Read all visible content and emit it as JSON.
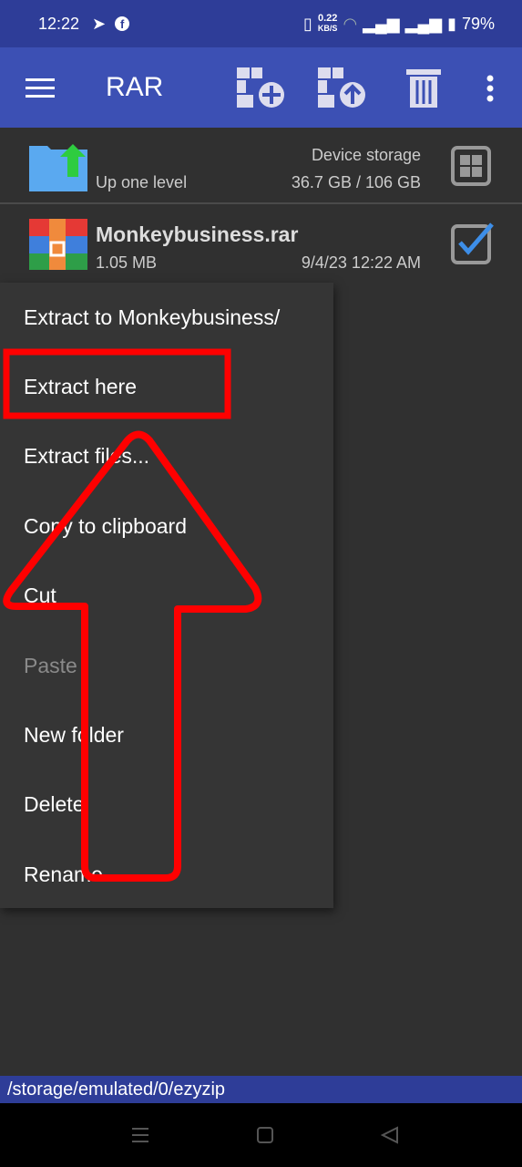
{
  "status": {
    "time": "12:22",
    "net_speed": "0.22",
    "net_unit": "KB/S",
    "battery": "79%"
  },
  "toolbar": {
    "title": "RAR"
  },
  "up_row": {
    "label": "Up one level",
    "storage_name": "Device storage",
    "storage_usage": "36.7 GB / 106 GB"
  },
  "file_row": {
    "name": "Monkeybusiness.rar",
    "size": "1.05 MB",
    "date": "9/4/23 12:22 AM",
    "checked": true
  },
  "menu": {
    "items": [
      {
        "label": "Extract to Monkeybusiness/"
      },
      {
        "label": "Extract here"
      },
      {
        "label": "Extract files..."
      },
      {
        "label": "Copy to clipboard"
      },
      {
        "label": "Cut"
      },
      {
        "label": "Paste",
        "disabled": true
      },
      {
        "label": "New folder"
      },
      {
        "label": "Delete"
      },
      {
        "label": "Rename"
      }
    ]
  },
  "path": "/storage/emulated/0/ezyzip",
  "annotation": {
    "color": "#ff0000",
    "highlight": "Extract here"
  }
}
